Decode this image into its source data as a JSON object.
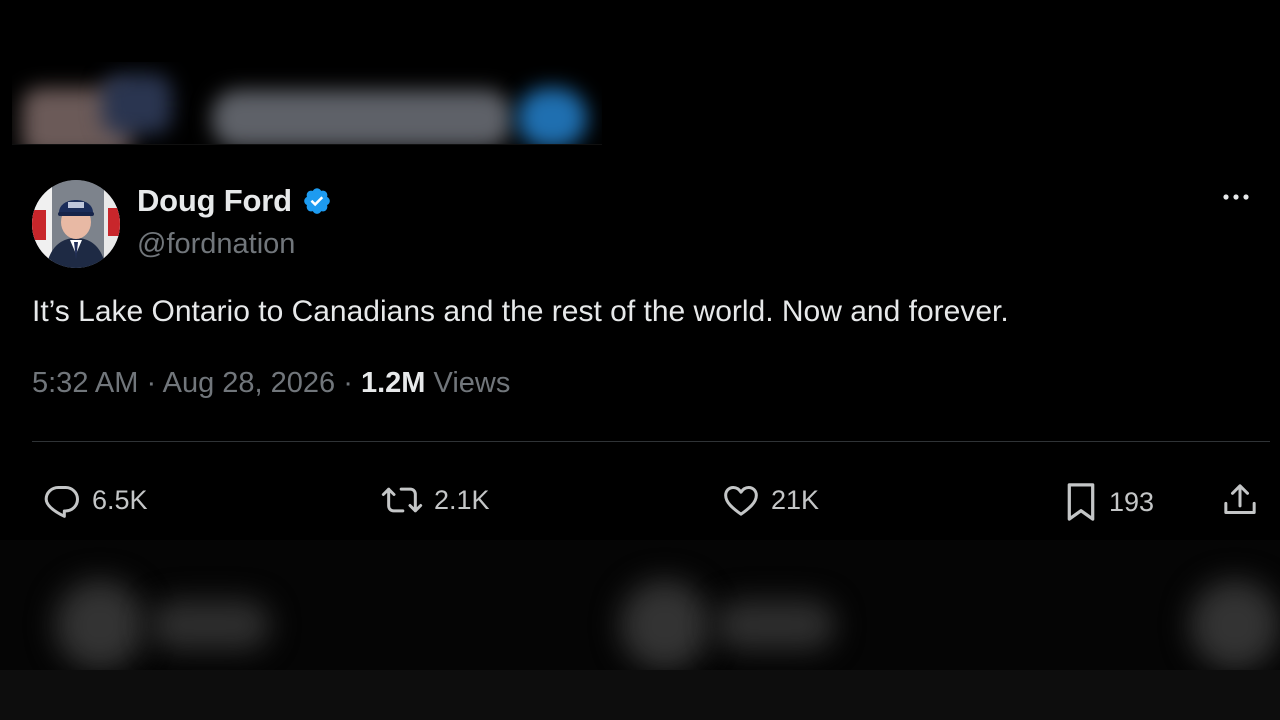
{
  "author": {
    "display_name": "Doug Ford",
    "handle": "@fordnation",
    "verified": true
  },
  "tweet": {
    "text": "It’s Lake Ontario to Canadians and the rest of the world. Now and forever.",
    "time": "5:32 AM",
    "separator": "·",
    "date": "Aug 28, 2026",
    "views_count": "1.2M",
    "views_label": "Views"
  },
  "actions": {
    "replies": "6.5K",
    "reposts": "2.1K",
    "likes": "21K",
    "bookmarks": "193"
  },
  "icons": {
    "verified": "verified-badge-icon",
    "more": "more-options-icon",
    "reply": "reply-icon",
    "repost": "repost-icon",
    "like": "heart-icon",
    "bookmark": "bookmark-icon",
    "share": "share-icon"
  },
  "colors": {
    "background": "#000000",
    "text_primary": "#e7e9ea",
    "text_secondary": "#71767b",
    "verified_blue": "#1d9bf0",
    "divider": "#2f3336"
  }
}
